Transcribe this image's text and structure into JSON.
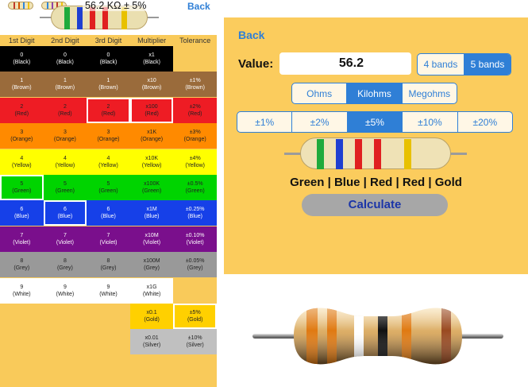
{
  "left_panel": {
    "header": {
      "value_text": "56.2 KΩ ± 5%",
      "back_label": "Back",
      "mini_resistors": [
        [
          "#c0392b",
          "#d35400",
          "#2e86de",
          "#f1c40f"
        ],
        [
          "#2e86de",
          "#8e44ad",
          "#c0392b",
          "#f1c40f"
        ]
      ],
      "resistor_bands": [
        "#1faa3c",
        "#1f3fd1",
        "#e02020",
        "#e02020",
        "#e8c100"
      ]
    },
    "columns": [
      "1st Digit",
      "2nd Digit",
      "3rd Digit",
      "Multiplier",
      "Tolerance"
    ],
    "rows": [
      {
        "color": "#000000",
        "text": "dark",
        "cells": [
          [
            "0",
            "(Black)"
          ],
          [
            "0",
            "(Black)"
          ],
          [
            "0",
            "(Black)"
          ],
          [
            "x1",
            "(Black)"
          ],
          null
        ]
      },
      {
        "color": "#9a6b3b",
        "text": "dark",
        "cells": [
          [
            "1",
            "(Brown)"
          ],
          [
            "1",
            "(Brown)"
          ],
          [
            "1",
            "(Brown)"
          ],
          [
            "x10",
            "(Brown)"
          ],
          [
            "±1%",
            "(Brown)"
          ]
        ]
      },
      {
        "color": "#ee1c24",
        "text": "light",
        "cells": [
          [
            "2",
            "(Red)"
          ],
          [
            "2",
            "(Red)"
          ],
          [
            "2",
            "(Red)"
          ],
          [
            "x100",
            "(Red)"
          ],
          [
            "±2%",
            "(Red)"
          ]
        ]
      },
      {
        "color": "#ff8a00",
        "text": "light",
        "cells": [
          [
            "3",
            "(Orange)"
          ],
          [
            "3",
            "(Orange)"
          ],
          [
            "3",
            "(Orange)"
          ],
          [
            "x1K",
            "(Orange)"
          ],
          [
            "±3%",
            "(Orange)"
          ]
        ]
      },
      {
        "color": "#ffff00",
        "text": "light",
        "cells": [
          [
            "4",
            "(Yellow)"
          ],
          [
            "4",
            "(Yellow)"
          ],
          [
            "4",
            "(Yellow)"
          ],
          [
            "x10K",
            "(Yellow)"
          ],
          [
            "±4%",
            "(Yellow)"
          ]
        ]
      },
      {
        "color": "#00d400",
        "text": "light",
        "cells": [
          [
            "5",
            "(Green)"
          ],
          [
            "5",
            "(Green)"
          ],
          [
            "5",
            "(Green)"
          ],
          [
            "x100K",
            "(Green)"
          ],
          [
            "±0.5%",
            "(Green)"
          ]
        ]
      },
      {
        "color": "#1640e8",
        "text": "dark",
        "cells": [
          [
            "6",
            "(Blue)"
          ],
          [
            "6",
            "(Blue)"
          ],
          [
            "6",
            "(Blue)"
          ],
          [
            "x1M",
            "(Blue)"
          ],
          [
            "±0.25%",
            "(Blue)"
          ]
        ]
      },
      {
        "color": "#7a0f8c",
        "text": "dark",
        "cells": [
          [
            "7",
            "(Violet)"
          ],
          [
            "7",
            "(Violet)"
          ],
          [
            "7",
            "(Violet)"
          ],
          [
            "x10M",
            "(Violet)"
          ],
          [
            "±0.10%",
            "(Violet)"
          ]
        ]
      },
      {
        "color": "#999999",
        "text": "light",
        "cells": [
          [
            "8",
            "(Grey)"
          ],
          [
            "8",
            "(Grey)"
          ],
          [
            "8",
            "(Grey)"
          ],
          [
            "x100M",
            "(Grey)"
          ],
          [
            "±0.05%",
            "(Grey)"
          ]
        ]
      },
      {
        "color": "#ffffff",
        "text": "light",
        "cells": [
          [
            "9",
            "(White)"
          ],
          [
            "9",
            "(White)"
          ],
          [
            "9",
            "(White)"
          ],
          [
            "x1G",
            "(White)"
          ],
          null
        ]
      },
      {
        "color": "#ffd000",
        "text": "light",
        "cells": [
          null,
          null,
          null,
          [
            "x0.1",
            "(Gold)"
          ],
          [
            "±5%",
            "(Gold)"
          ]
        ]
      },
      {
        "color": "#c0c0c0",
        "text": "light",
        "cells": [
          null,
          null,
          null,
          [
            "x0.01",
            "(Silver)"
          ],
          [
            "±10%",
            "(Silver)"
          ]
        ]
      }
    ],
    "selected": [
      [
        5,
        0
      ],
      [
        6,
        1
      ],
      [
        2,
        2
      ],
      [
        2,
        3
      ],
      [
        10,
        4
      ]
    ]
  },
  "calculator": {
    "back_label": "Back",
    "value_label": "Value:",
    "value": "56.2",
    "band_options": [
      {
        "label": "4 bands",
        "on": false
      },
      {
        "label": "5 bands",
        "on": true
      }
    ],
    "unit_options": [
      {
        "label": "Ohms",
        "on": false
      },
      {
        "label": "Kilohms",
        "on": true
      },
      {
        "label": "Megohms",
        "on": false
      }
    ],
    "tolerance_options": [
      {
        "label": "±1%",
        "on": false
      },
      {
        "label": "±2%",
        "on": false
      },
      {
        "label": "±5%",
        "on": true
      },
      {
        "label": "±10%",
        "on": false
      },
      {
        "label": "±20%",
        "on": false
      }
    ],
    "resistor_bands": [
      "#1faa3c",
      "#1f3fd1",
      "#e02020",
      "#e02020",
      "#e8c100"
    ],
    "color_names": "Green | Blue | Red | Red | Gold",
    "calculate_label": "Calculate"
  },
  "photo_resistor": {
    "bands": [
      "#e07a12",
      "#e07a12",
      "#ffffff",
      "#111111",
      "#e07a12",
      "#9a4a20"
    ]
  }
}
